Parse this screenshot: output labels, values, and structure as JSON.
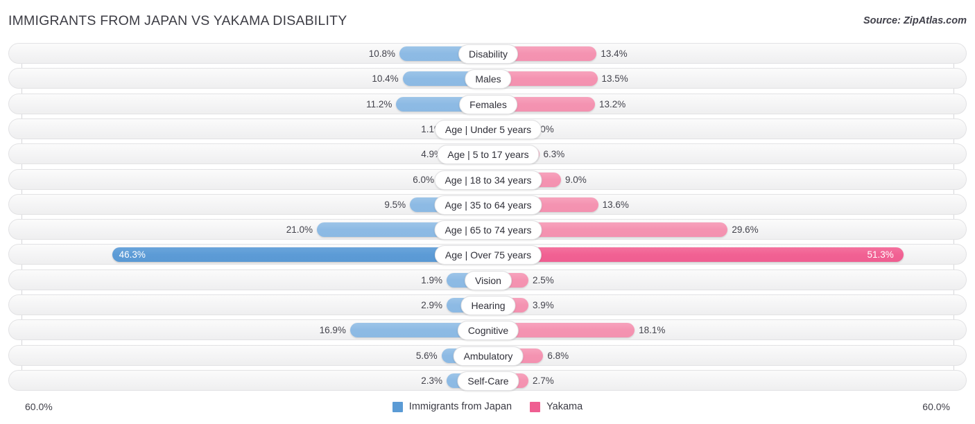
{
  "header": {
    "title": "IMMIGRANTS FROM JAPAN VS YAKAMA DISABILITY",
    "source": "Source: ZipAtlas.com"
  },
  "axis": {
    "left_label": "60.0%",
    "right_label": "60.0%",
    "max": 60.0
  },
  "legend": {
    "items": [
      {
        "label": "Immigrants from Japan",
        "color": "#5b9bd5"
      },
      {
        "label": "Yakama",
        "color": "#ef5e91"
      }
    ]
  },
  "colors": {
    "left_normal": "#8dbae4",
    "left_max": "#5b9bd5",
    "right_normal": "#f493b1",
    "right_max": "#f16193"
  },
  "chart_data": {
    "type": "bar",
    "title": "IMMIGRANTS FROM JAPAN VS YAKAMA DISABILITY",
    "orientation": "horizontal-diverging",
    "xlabel": "",
    "ylabel": "",
    "xlim": [
      -60.0,
      60.0
    ],
    "grid": true,
    "legend_position": "bottom-center",
    "categories": [
      "Disability",
      "Males",
      "Females",
      "Age | Under 5 years",
      "Age | 5 to 17 years",
      "Age | 18 to 34 years",
      "Age | 35 to 64 years",
      "Age | 65 to 74 years",
      "Age | Over 75 years",
      "Vision",
      "Hearing",
      "Cognitive",
      "Ambulatory",
      "Self-Care"
    ],
    "series": [
      {
        "name": "Immigrants from Japan",
        "side": "left",
        "values": [
          10.8,
          10.4,
          11.2,
          1.1,
          4.9,
          6.0,
          9.5,
          21.0,
          46.3,
          1.9,
          2.9,
          16.9,
          5.6,
          2.3
        ]
      },
      {
        "name": "Yakama",
        "side": "right",
        "values": [
          13.4,
          13.5,
          13.2,
          1.0,
          6.3,
          9.0,
          13.6,
          29.6,
          51.3,
          2.5,
          3.9,
          18.1,
          6.8,
          2.7
        ]
      }
    ],
    "rows": [
      {
        "label": "Disability",
        "left": "10.8%",
        "right": "13.4%",
        "left_value": 10.8,
        "right_value": 13.4,
        "highlight": false
      },
      {
        "label": "Males",
        "left": "10.4%",
        "right": "13.5%",
        "left_value": 10.4,
        "right_value": 13.5,
        "highlight": false
      },
      {
        "label": "Females",
        "left": "11.2%",
        "right": "13.2%",
        "left_value": 11.2,
        "right_value": 13.2,
        "highlight": false
      },
      {
        "label": "Age | Under 5 years",
        "left": "1.1%",
        "right": "1.0%",
        "left_value": 1.1,
        "right_value": 1.0,
        "highlight": false
      },
      {
        "label": "Age | 5 to 17 years",
        "left": "4.9%",
        "right": "6.3%",
        "left_value": 4.9,
        "right_value": 6.3,
        "highlight": false
      },
      {
        "label": "Age | 18 to 34 years",
        "left": "6.0%",
        "right": "9.0%",
        "left_value": 6.0,
        "right_value": 9.0,
        "highlight": false
      },
      {
        "label": "Age | 35 to 64 years",
        "left": "9.5%",
        "right": "13.6%",
        "left_value": 9.5,
        "right_value": 13.6,
        "highlight": false
      },
      {
        "label": "Age | 65 to 74 years",
        "left": "21.0%",
        "right": "29.6%",
        "left_value": 21.0,
        "right_value": 29.6,
        "highlight": false
      },
      {
        "label": "Age | Over 75 years",
        "left": "46.3%",
        "right": "51.3%",
        "left_value": 46.3,
        "right_value": 51.3,
        "highlight": true
      },
      {
        "label": "Vision",
        "left": "1.9%",
        "right": "2.5%",
        "left_value": 1.9,
        "right_value": 2.5,
        "highlight": false
      },
      {
        "label": "Hearing",
        "left": "2.9%",
        "right": "3.9%",
        "left_value": 2.9,
        "right_value": 3.9,
        "highlight": false
      },
      {
        "label": "Cognitive",
        "left": "16.9%",
        "right": "18.1%",
        "left_value": 16.9,
        "right_value": 18.1,
        "highlight": false
      },
      {
        "label": "Ambulatory",
        "left": "5.6%",
        "right": "6.8%",
        "left_value": 5.6,
        "right_value": 6.8,
        "highlight": false
      },
      {
        "label": "Self-Care",
        "left": "2.3%",
        "right": "2.7%",
        "left_value": 2.3,
        "right_value": 2.7,
        "highlight": false
      }
    ]
  }
}
